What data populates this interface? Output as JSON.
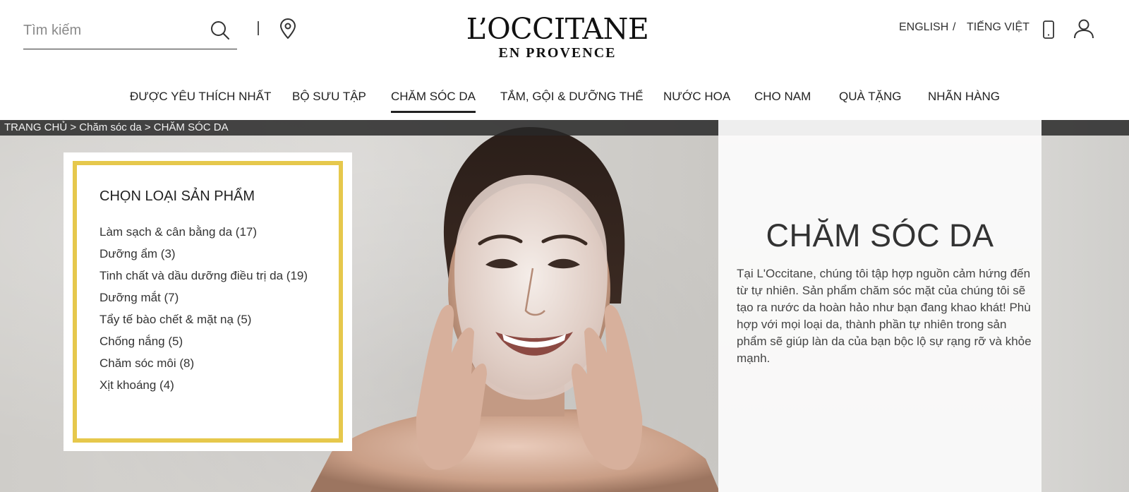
{
  "header": {
    "search_placeholder": "Tìm kiếm",
    "logo_main": "L’OCCITANE",
    "logo_sub": "EN PROVENCE",
    "lang_english": "ENGLISH",
    "lang_separator": "/",
    "lang_vietnamese": "TIẾNG VIỆT"
  },
  "nav": {
    "items": [
      {
        "label": "ĐƯỢC YÊU THÍCH NHẤT"
      },
      {
        "label": "BỘ SƯU TẬP"
      },
      {
        "label": "CHĂM SÓC DA"
      },
      {
        "label": "TẮM, GỘI & DƯỠNG THỂ"
      },
      {
        "label": "NƯỚC HOA"
      },
      {
        "label": "CHO NAM"
      },
      {
        "label": "QUÀ TẶNG"
      },
      {
        "label": "NHÃN HÀNG"
      }
    ],
    "active_index": 2
  },
  "breadcrumb": {
    "home": "TRANG CHỦ",
    "sep1": ">",
    "category": "Chăm sóc da",
    "sep2": ">",
    "current": "CHĂM SÓC DA"
  },
  "category_filter": {
    "title": "CHỌN LOẠI SẢN PHẨM",
    "items": [
      {
        "label": "Làm sạch & cân bằng da (17)"
      },
      {
        "label": "Dưỡng ẩm (3)"
      },
      {
        "label": "Tinh chất và dầu dưỡng điều trị da (19)"
      },
      {
        "label": "Dưỡng mắt (7)"
      },
      {
        "label": "Tẩy tế bào chết & mặt nạ (5)"
      },
      {
        "label": "Chống nắng (5)"
      },
      {
        "label": "Chăm sóc môi (8)"
      },
      {
        "label": "Xịt khoáng (4)"
      }
    ],
    "frame_color": "#e6c84c"
  },
  "hero": {
    "title": "CHĂM SÓC DA",
    "description": "Tại L'Occitane, chúng tôi tập hợp nguồn cảm hứng đến từ tự nhiên. Sản phẩm chăm sóc mặt của chúng tôi sẽ tạo ra nước da hoàn hảo như bạn đang khao khát! Phù hợp với mọi loại da, thành phần tự nhiên trong sản phẩm sẽ giúp làn da của bạn bộc lộ sự rạng rỡ và khỏe mạnh."
  },
  "icons": {
    "search": "search-icon",
    "location": "location-pin-icon",
    "phone": "phone-icon",
    "user": "user-icon"
  }
}
